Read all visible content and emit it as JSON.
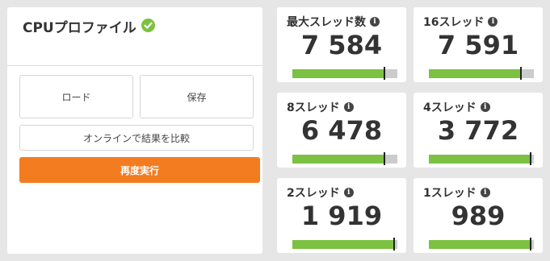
{
  "profile": {
    "title": "CPUプロファイル",
    "status_icon": "check-circle-icon",
    "status_color": "#7cc142"
  },
  "buttons": {
    "load": "ロード",
    "save": "保存",
    "compare": "オンラインで結果を比較",
    "rerun": "再度実行",
    "rerun_color": "#f47c20"
  },
  "cards": [
    {
      "label": "最大スレッド数",
      "value": "7 584",
      "bar_fill_fraction": 0.88
    },
    {
      "label": "16スレッド",
      "value": "7 591",
      "bar_fill_fraction": 0.88
    },
    {
      "label": "8スレッド",
      "value": "6 478",
      "bar_fill_fraction": 0.88
    },
    {
      "label": "4スレッド",
      "value": "3 772",
      "bar_fill_fraction": 0.98
    },
    {
      "label": "2スレッド",
      "value": "1 919",
      "bar_fill_fraction": 0.98
    },
    {
      "label": "1スレッド",
      "value": "989",
      "bar_fill_fraction": 0.98
    }
  ],
  "bar_color": "#7cc142"
}
